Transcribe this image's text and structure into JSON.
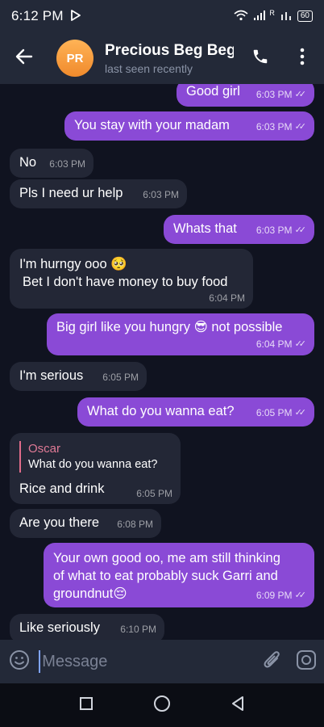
{
  "status_bar": {
    "time": "6:12 PM",
    "battery": "60",
    "signal": "R"
  },
  "header": {
    "avatar_initials": "PR",
    "contact_name": "Precious Beg Beg",
    "contact_status": "last seen recently"
  },
  "messages": [
    {
      "dir": "out",
      "text": "Good girl",
      "time": "6:03 PM"
    },
    {
      "dir": "out",
      "text": "You stay with your madam",
      "time": "6:03 PM"
    },
    {
      "dir": "in",
      "text": "No",
      "time": "6:03 PM"
    },
    {
      "dir": "in",
      "text": "Pls I need ur help",
      "time": "6:03 PM"
    },
    {
      "dir": "out",
      "text": "Whats that",
      "time": "6:03 PM"
    },
    {
      "dir": "in",
      "lines": [
        "I'm hurngy ooo 🥺",
        "Bet I don't have money to buy food"
      ],
      "time": "6:04 PM"
    },
    {
      "dir": "out",
      "text": "Big girl like you hungry 😎 not possible",
      "time": "6:04 PM"
    },
    {
      "dir": "in",
      "text": "I'm serious",
      "time": "6:05 PM"
    },
    {
      "dir": "out",
      "text": "What do you wanna eat?",
      "time": "6:05 PM"
    },
    {
      "dir": "in",
      "reply_to": {
        "name": "Oscar",
        "text": "What do you wanna eat?"
      },
      "text": "Rice and drink",
      "time": "6:05 PM"
    },
    {
      "dir": "in",
      "text": "Are you there",
      "time": "6:08 PM"
    },
    {
      "dir": "out",
      "lines": [
        "Your own good oo, me am still thinking",
        "of what to eat probably suck Garri and",
        "groundnut😔"
      ],
      "time": "6:09 PM"
    },
    {
      "dir": "in",
      "text": "Like seriously",
      "time": "6:10 PM"
    }
  ],
  "input": {
    "placeholder": "Message"
  },
  "colors": {
    "background": "#101320",
    "bar": "#232938",
    "outgoing": "#8a4ad6",
    "incoming": "#232736",
    "avatar": "#f59b3c",
    "reply_accent": "#e06c8a"
  },
  "icons": {
    "back": "arrow-left-icon",
    "call": "phone-icon",
    "more": "more-vertical-icon",
    "emoji": "emoji-icon",
    "attach": "paperclip-icon",
    "camera": "camera-icon",
    "nav_recents": "square-icon",
    "nav_home": "circle-icon",
    "nav_back": "triangle-icon"
  }
}
